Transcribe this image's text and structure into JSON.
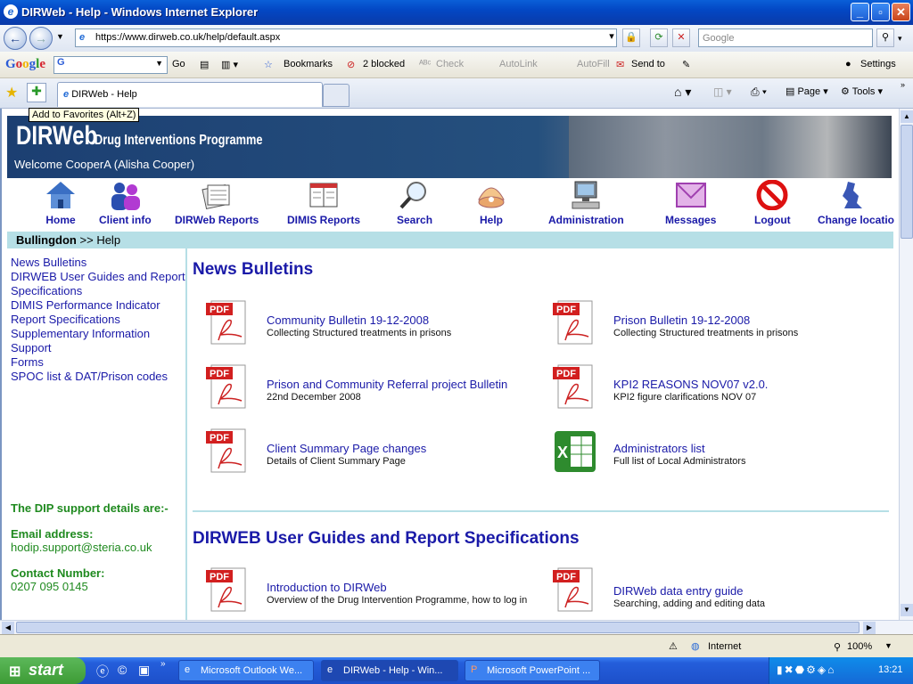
{
  "window": {
    "title": "DIRWeb - Help - Windows Internet Explorer"
  },
  "nav": {
    "url": "https://www.dirweb.co.uk/help/default.aspx",
    "search_placeholder": "Google"
  },
  "gtoolbar": {
    "go": "Go",
    "bookmarks": "Bookmarks",
    "blocked": "2 blocked",
    "check": "Check",
    "autolink": "AutoLink",
    "autofill": "AutoFill",
    "sendto": "Send to",
    "settings": "Settings"
  },
  "tabs": {
    "active": "DIRWeb - Help",
    "page": "Page",
    "tools": "Tools"
  },
  "tooltip": "Add to Favorites (Alt+Z)",
  "header": {
    "logo": "DIRWeb",
    "programme": "Drug Interventions Programme",
    "welcome": "Welcome CooperA (Alisha Cooper)"
  },
  "menu": [
    {
      "label": "Home",
      "icon": "home-icon"
    },
    {
      "label": "Client info",
      "icon": "people-icon"
    },
    {
      "label": "DIRWeb Reports",
      "icon": "reports-icon"
    },
    {
      "label": "DIMIS Reports",
      "icon": "dimis-reports-icon"
    },
    {
      "label": "Search",
      "icon": "magnifier-icon"
    },
    {
      "label": "Help",
      "icon": "shell-icon"
    },
    {
      "label": "Administration",
      "icon": "computer-icon"
    },
    {
      "label": "Messages",
      "icon": "envelope-icon"
    },
    {
      "label": "Logout",
      "icon": "no-entry-icon"
    },
    {
      "label": "Change locatio",
      "icon": "map-icon"
    }
  ],
  "breadcrumb": {
    "site": "Bullingdon",
    "sep": ">>",
    "page": "Help"
  },
  "sidebar": {
    "links": [
      "News Bulletins",
      "DIRWEB User Guides and Report Specifications",
      "DIMIS Performance Indicator Report Specifications",
      "Supplementary Information",
      "Support",
      "Forms",
      "SPOC list & DAT/Prison codes"
    ],
    "support_heading": "The DIP support details are:-",
    "email_label": "Email address:",
    "email": "hodip.support@steria.co.uk",
    "contact_label": "Contact Number:",
    "phone": "0207 095 0145"
  },
  "sections": [
    {
      "title": "News Bulletins",
      "docs": [
        {
          "type": "pdf",
          "title": "Community Bulletin 19-12-2008",
          "desc": "Collecting Structured treatments in prisons"
        },
        {
          "type": "pdf",
          "title": "Prison Bulletin 19-12-2008",
          "desc": "Collecting Structured treatments in prisons"
        },
        {
          "type": "pdf",
          "title": "Prison and Community Referral project Bulletin",
          "desc": "22nd December 2008"
        },
        {
          "type": "pdf",
          "title": "KPI2 REASONS NOV07 v2.0.",
          "desc": "KPI2 figure clarifications NOV 07"
        },
        {
          "type": "pdf",
          "title": "Client Summary Page changes",
          "desc": "Details of Client Summary Page"
        },
        {
          "type": "excel",
          "title": "Administrators list",
          "desc": "Full list of Local Administrators"
        }
      ]
    },
    {
      "title": "DIRWEB User Guides and Report Specifications",
      "docs": [
        {
          "type": "pdf",
          "title": "Introduction to DIRWeb",
          "desc": "Overview of the Drug Intervention Programme, how to log in"
        },
        {
          "type": "pdf",
          "title": "DIRWeb data entry guide",
          "desc": "Searching, adding and editing data"
        }
      ]
    }
  ],
  "status": {
    "zone": "Internet",
    "zoom": "100%"
  },
  "taskbar": {
    "start": "start",
    "tasks": [
      "Microsoft Outlook We...",
      "DIRWeb - Help - Win...",
      "Microsoft PowerPoint ..."
    ],
    "clock": "13:21"
  }
}
